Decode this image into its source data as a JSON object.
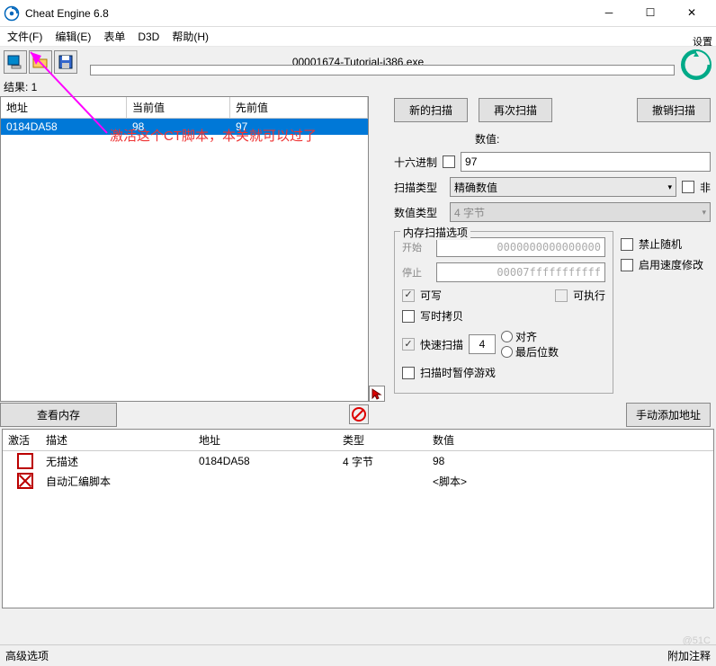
{
  "window": {
    "title": "Cheat Engine 6.8"
  },
  "menu": {
    "file": "文件(F)",
    "edit": "编辑(E)",
    "table": "表单",
    "d3d": "D3D",
    "help": "帮助(H)"
  },
  "toolbar": {
    "process_name": "00001674-Tutorial-i386.exe",
    "settings": "设置"
  },
  "results": {
    "label": "结果: 1"
  },
  "addr_table": {
    "head_addr": "地址",
    "head_cur": "当前值",
    "head_prev": "先前值",
    "rows": [
      {
        "addr": "0184DA58",
        "cur": "98",
        "prev": "97"
      }
    ]
  },
  "left_buttons": {
    "view_memory": "查看内存"
  },
  "scan": {
    "new": "新的扫描",
    "again": "再次扫描",
    "undo": "撤销扫描",
    "value_lbl": "数值:",
    "hex_lbl": "十六进制",
    "value_input": "97",
    "scantype_lbl": "扫描类型",
    "scantype_val": "精确数值",
    "not_lbl": "非",
    "valtype_lbl": "数值类型",
    "valtype_val": "4 字节",
    "memopt_legend": "内存扫描选项",
    "start_lbl": "开始",
    "start_val": "0000000000000000",
    "stop_lbl": "停止",
    "stop_val": "00007fffffffffff",
    "writable": "可写",
    "executable": "可执行",
    "cow": "写时拷贝",
    "fast": "快速扫描",
    "fast_val": "4",
    "align": "对齐",
    "lastdigit": "最后位数",
    "pause": "扫描时暂停游戏",
    "norand": "禁止随机",
    "speedhack": "启用速度修改",
    "manual_add": "手动添加地址"
  },
  "bottom": {
    "head_active": "激活",
    "head_desc": "描述",
    "head_addr": "地址",
    "head_type": "类型",
    "head_val": "数值",
    "rows": [
      {
        "active": false,
        "desc": "无描述",
        "addr": "0184DA58",
        "type": "4 字节",
        "val": "98"
      },
      {
        "active": true,
        "desc": "自动汇编脚本",
        "addr": "",
        "type": "",
        "val": "<脚本>"
      }
    ]
  },
  "footer": {
    "adv": "高级选项",
    "comment": "附加注释"
  },
  "annotation": {
    "text": "激活这个CT脚本，本关就可以过了"
  },
  "watermark": "@51C"
}
